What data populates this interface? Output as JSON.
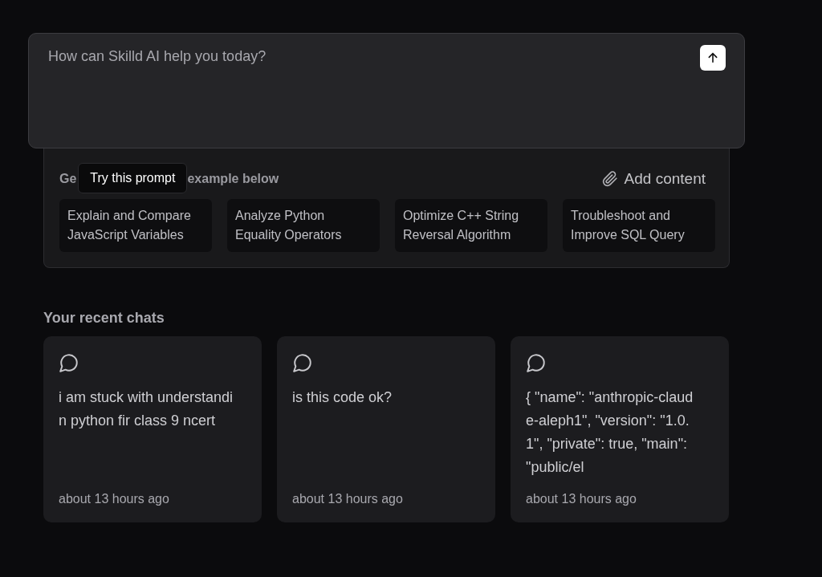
{
  "prompt_box": {
    "placeholder": "How can Skilld AI help you today?"
  },
  "examples": {
    "heading_start": "Ge",
    "tooltip": "Try this prompt",
    "heading_end": "example below",
    "add_content": "Add content",
    "prompts": [
      "Explain and Compare JavaScript Variables",
      "Analyze Python Equality Operators",
      "Optimize C++ String Reversal Algorithm",
      "Troubleshoot and Improve SQL Query"
    ]
  },
  "recent_chats": {
    "heading": "Your recent chats",
    "chats": [
      {
        "text": "i am stuck with understandin python fir class 9 ncert",
        "time": "about 13 hours ago"
      },
      {
        "text": "is this code ok?",
        "time": "about 13 hours ago"
      },
      {
        "text": "{ \"name\": \"anthropic-claude-aleph1\", \"version\": \"1.0.1\", \"private\": true, \"main\": \"public/el",
        "time": "about 13 hours ago"
      }
    ]
  }
}
